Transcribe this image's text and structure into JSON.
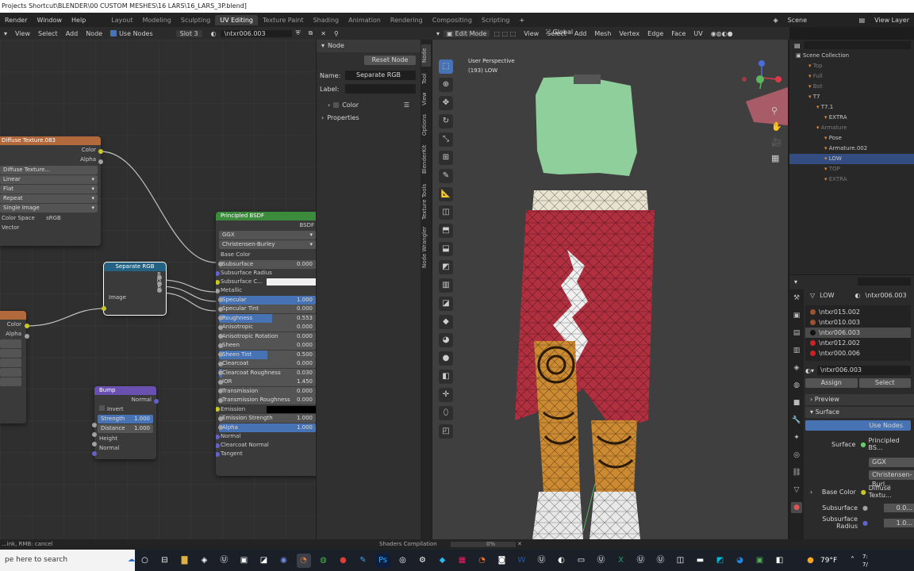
{
  "window": {
    "title": "Projects Shortcut\\BLENDER\\00 CUSTOM MESHES\\16 LARS\\16_LARS_3P.blend]"
  },
  "menu": {
    "items": [
      "Render",
      "Window",
      "Help"
    ],
    "workspaces": [
      "Layout",
      "Modeling",
      "Sculpting",
      "UV Editing",
      "Texture Paint",
      "Shading",
      "Animation",
      "Rendering",
      "Compositing",
      "Scripting"
    ],
    "active_workspace": "UV Editing",
    "scene": "Scene",
    "view_layer": "View Layer"
  },
  "node_editor": {
    "header": {
      "items": [
        "View",
        "Select",
        "Add",
        "Node"
      ],
      "use_nodes": "Use Nodes",
      "slot": "Slot 3",
      "material": "\\ntxr006.003"
    },
    "nodes": {
      "diffuse": {
        "title": "Diffuse Texture.083",
        "out_color": "Color",
        "out_alpha": "Alpha",
        "image_name": "Diffuse Texture...",
        "interpolation": "Linear",
        "projection": "Flat",
        "extension": "Repeat",
        "source": "Single Image",
        "color_space_label": "Color Space",
        "color_space": "sRGB",
        "vector": "Vector"
      },
      "separate": {
        "title": "Separate RGB",
        "r": "R",
        "g": "G",
        "b": "B",
        "image": "Image"
      },
      "partial": {
        "color": "Color",
        "alpha": "Alpha"
      },
      "bump": {
        "title": "Bump",
        "normal_out": "Normal",
        "invert": "Invert",
        "strength_label": "Strength",
        "strength": "1.000",
        "distance_label": "Distance",
        "distance": "1.000",
        "height": "Height",
        "normal": "Normal"
      },
      "bsdf": {
        "title": "Principled BSDF",
        "bsdf_out": "BSDF",
        "distribution": "GGX",
        "subsurface_method": "Christensen-Burley",
        "base_color": "Base Color",
        "fields": [
          {
            "label": "Subsurface",
            "value": "0.000",
            "fill": 0
          },
          {
            "label": "Subsurface Radius",
            "value": "",
            "fill": 0
          },
          {
            "label": "Subsurface C...",
            "value": "",
            "fill": 0
          },
          {
            "label": "Metallic",
            "value": "",
            "fill": 0
          },
          {
            "label": "Specular",
            "value": "1.000",
            "fill": 100
          },
          {
            "label": "Specular Tint",
            "value": "0.000",
            "fill": 0
          },
          {
            "label": "Roughness",
            "value": "0.553",
            "fill": 55
          },
          {
            "label": "Anisotropic",
            "value": "0.000",
            "fill": 0
          },
          {
            "label": "Anisotropic Rotation",
            "value": "0.000",
            "fill": 0
          },
          {
            "label": "Sheen",
            "value": "0.000",
            "fill": 0
          },
          {
            "label": "Sheen Tint",
            "value": "0.500",
            "fill": 50
          },
          {
            "label": "Clearcoat",
            "value": "0.000",
            "fill": 0
          },
          {
            "label": "Clearcoat Roughness",
            "value": "0.030",
            "fill": 3
          },
          {
            "label": "IOR",
            "value": "1.450",
            "fill": 0
          },
          {
            "label": "Transmission",
            "value": "0.000",
            "fill": 0
          },
          {
            "label": "Transmission Roughness",
            "value": "0.000",
            "fill": 0
          },
          {
            "label": "Emission",
            "value": "",
            "fill": 0
          },
          {
            "label": "Emission Strength",
            "value": "1.000",
            "fill": 0
          },
          {
            "label": "Alpha",
            "value": "1.000",
            "fill": 100
          },
          {
            "label": "Normal",
            "value": "",
            "fill": 0
          },
          {
            "label": "Clearcoat Normal",
            "value": "",
            "fill": 0
          },
          {
            "label": "Tangent",
            "value": "",
            "fill": 0
          }
        ]
      }
    }
  },
  "node_sidebar": {
    "tab": "Node",
    "reset_button": "Reset Node",
    "name_label": "Name:",
    "name_value": "Separate RGB",
    "label_label": "Label:",
    "color_label": "Color",
    "properties_label": "Properties",
    "vtabs": [
      "Node",
      "Tool",
      "View",
      "Options",
      "BlenderKit",
      "Texture Tools",
      "Node Wrangler"
    ]
  },
  "viewport": {
    "header": {
      "mode": "Edit Mode",
      "items": [
        "View",
        "Select",
        "Add",
        "Mesh",
        "Vertex",
        "Edge",
        "Face",
        "UV"
      ],
      "orientation": "Global"
    },
    "overlay_title": "User Perspective",
    "overlay_subtitle": "(193) LOW"
  },
  "outliner": {
    "title": "Scene Collection",
    "rows": [
      {
        "label": "Top",
        "indent": 1,
        "selected": false,
        "dim": true
      },
      {
        "label": "Full",
        "indent": 1,
        "selected": false,
        "dim": true
      },
      {
        "label": "Bot",
        "indent": 1,
        "selected": false,
        "dim": true
      },
      {
        "label": "T7",
        "indent": 1,
        "selected": false,
        "dim": false
      },
      {
        "label": "T7.1",
        "indent": 2,
        "selected": false,
        "dim": false
      },
      {
        "label": "EXTRA",
        "indent": 3,
        "selected": false,
        "dim": false
      },
      {
        "label": "Armature",
        "indent": 2,
        "selected": false,
        "dim": true
      },
      {
        "label": "Pose",
        "indent": 3,
        "selected": false,
        "dim": false
      },
      {
        "label": "Armature.002",
        "indent": 3,
        "selected": false,
        "dim": false
      },
      {
        "label": "LOW",
        "indent": 3,
        "selected": true,
        "dim": false
      },
      {
        "label": "TOP",
        "indent": 3,
        "selected": false,
        "dim": true
      },
      {
        "label": "EXTRA",
        "indent": 3,
        "selected": false,
        "dim": true
      }
    ]
  },
  "properties": {
    "object": "LOW",
    "material": "\\ntxr006.003",
    "slots": [
      {
        "label": "\\ntxr015.002",
        "color": "#a0522d"
      },
      {
        "label": "\\ntxr010.003",
        "color": "#a0522d"
      },
      {
        "label": "\\ntxr006.003",
        "color": "#111111"
      },
      {
        "label": "\\ntxr012.002",
        "color": "#cc2222"
      },
      {
        "label": "\\ntxr000.006",
        "color": "#cc2222"
      }
    ],
    "selected_slot": 2,
    "material_name": "\\ntxr006.003",
    "assign": "Assign",
    "select": "Select",
    "preview": "Preview",
    "surface_panel": "Surface",
    "use_nodes": "Use Nodes",
    "surface_label": "Surface",
    "surface_value": "Principled BS...",
    "distribution": "GGX",
    "subsurface_method": "Christensen-Burl...",
    "base_color_label": "Base Color",
    "base_color_value": "Diffuse Textu...",
    "subsurface_label": "Subsurface",
    "subsurface_value": "0.0...",
    "subsurface_radius_label": "Subsurface Radius",
    "subsurface_radius_value": "1.0..."
  },
  "status": {
    "left": "...ink, RMB: cancel",
    "center": "Shaders Compilation",
    "progress": "0%"
  },
  "taskbar": {
    "search_placeholder": "pe here to search",
    "weather": "79°F",
    "time": "7:",
    "date": "7/"
  }
}
